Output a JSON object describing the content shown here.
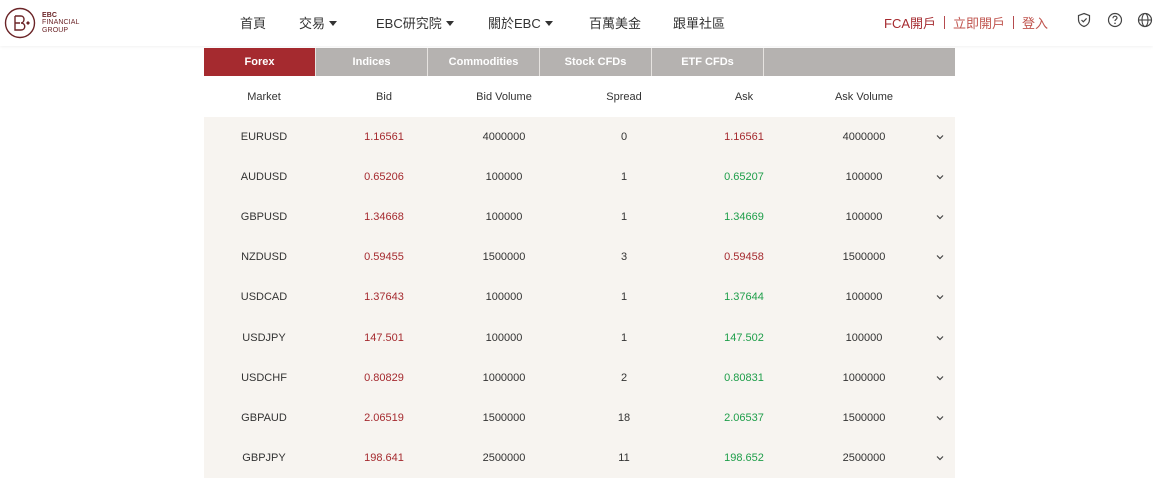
{
  "brand": {
    "logo_line1": "EBC",
    "logo_line2": "FINANCIAL",
    "logo_line3": "GROUP",
    "color": "#6b2427"
  },
  "nav": {
    "items": [
      {
        "label": "首頁",
        "dropdown": false
      },
      {
        "label": "交易",
        "dropdown": true
      },
      {
        "label": "EBC研究院",
        "dropdown": true
      },
      {
        "label": "關於EBC",
        "dropdown": true
      },
      {
        "label": "百萬美金",
        "dropdown": false
      },
      {
        "label": "跟單社區",
        "dropdown": false
      }
    ]
  },
  "account": {
    "fca": "FCA開戶",
    "open": "立即開戶",
    "login": "登入"
  },
  "header_icons": [
    "shield-check-icon",
    "help-icon",
    "globe-icon"
  ],
  "tabs": [
    {
      "label": "Forex",
      "active": true
    },
    {
      "label": "Indices",
      "active": false
    },
    {
      "label": "Commodities",
      "active": false
    },
    {
      "label": "Stock CFDs",
      "active": false
    },
    {
      "label": "ETF CFDs",
      "active": false
    }
  ],
  "table": {
    "headers": {
      "market": "Market",
      "bid": "Bid",
      "bid_volume": "Bid Volume",
      "spread": "Spread",
      "ask": "Ask",
      "ask_volume": "Ask Volume"
    },
    "rows": [
      {
        "market": "EURUSD",
        "bid": "1.16561",
        "bid_volume": "4000000",
        "spread": "0",
        "ask": "1.16561",
        "ask_volume": "4000000",
        "ask_dir": "down"
      },
      {
        "market": "AUDUSD",
        "bid": "0.65206",
        "bid_volume": "100000",
        "spread": "1",
        "ask": "0.65207",
        "ask_volume": "100000",
        "ask_dir": "up"
      },
      {
        "market": "GBPUSD",
        "bid": "1.34668",
        "bid_volume": "100000",
        "spread": "1",
        "ask": "1.34669",
        "ask_volume": "100000",
        "ask_dir": "up"
      },
      {
        "market": "NZDUSD",
        "bid": "0.59455",
        "bid_volume": "1500000",
        "spread": "3",
        "ask": "0.59458",
        "ask_volume": "1500000",
        "ask_dir": "down"
      },
      {
        "market": "USDCAD",
        "bid": "1.37643",
        "bid_volume": "100000",
        "spread": "1",
        "ask": "1.37644",
        "ask_volume": "100000",
        "ask_dir": "up"
      },
      {
        "market": "USDJPY",
        "bid": "147.501",
        "bid_volume": "100000",
        "spread": "1",
        "ask": "147.502",
        "ask_volume": "100000",
        "ask_dir": "up"
      },
      {
        "market": "USDCHF",
        "bid": "0.80829",
        "bid_volume": "1000000",
        "spread": "2",
        "ask": "0.80831",
        "ask_volume": "1000000",
        "ask_dir": "up"
      },
      {
        "market": "GBPAUD",
        "bid": "2.06519",
        "bid_volume": "1500000",
        "spread": "18",
        "ask": "2.06537",
        "ask_volume": "1500000",
        "ask_dir": "up"
      },
      {
        "market": "GBPJPY",
        "bid": "198.641",
        "bid_volume": "2500000",
        "spread": "11",
        "ask": "198.652",
        "ask_volume": "2500000",
        "ask_dir": "up"
      }
    ]
  },
  "colors": {
    "accent": "#a52a2f",
    "up": "#1e9e4a",
    "down": "#a52a2f",
    "tab_inactive": "#b5b2b0",
    "row_bg": "#f7f4f0"
  }
}
